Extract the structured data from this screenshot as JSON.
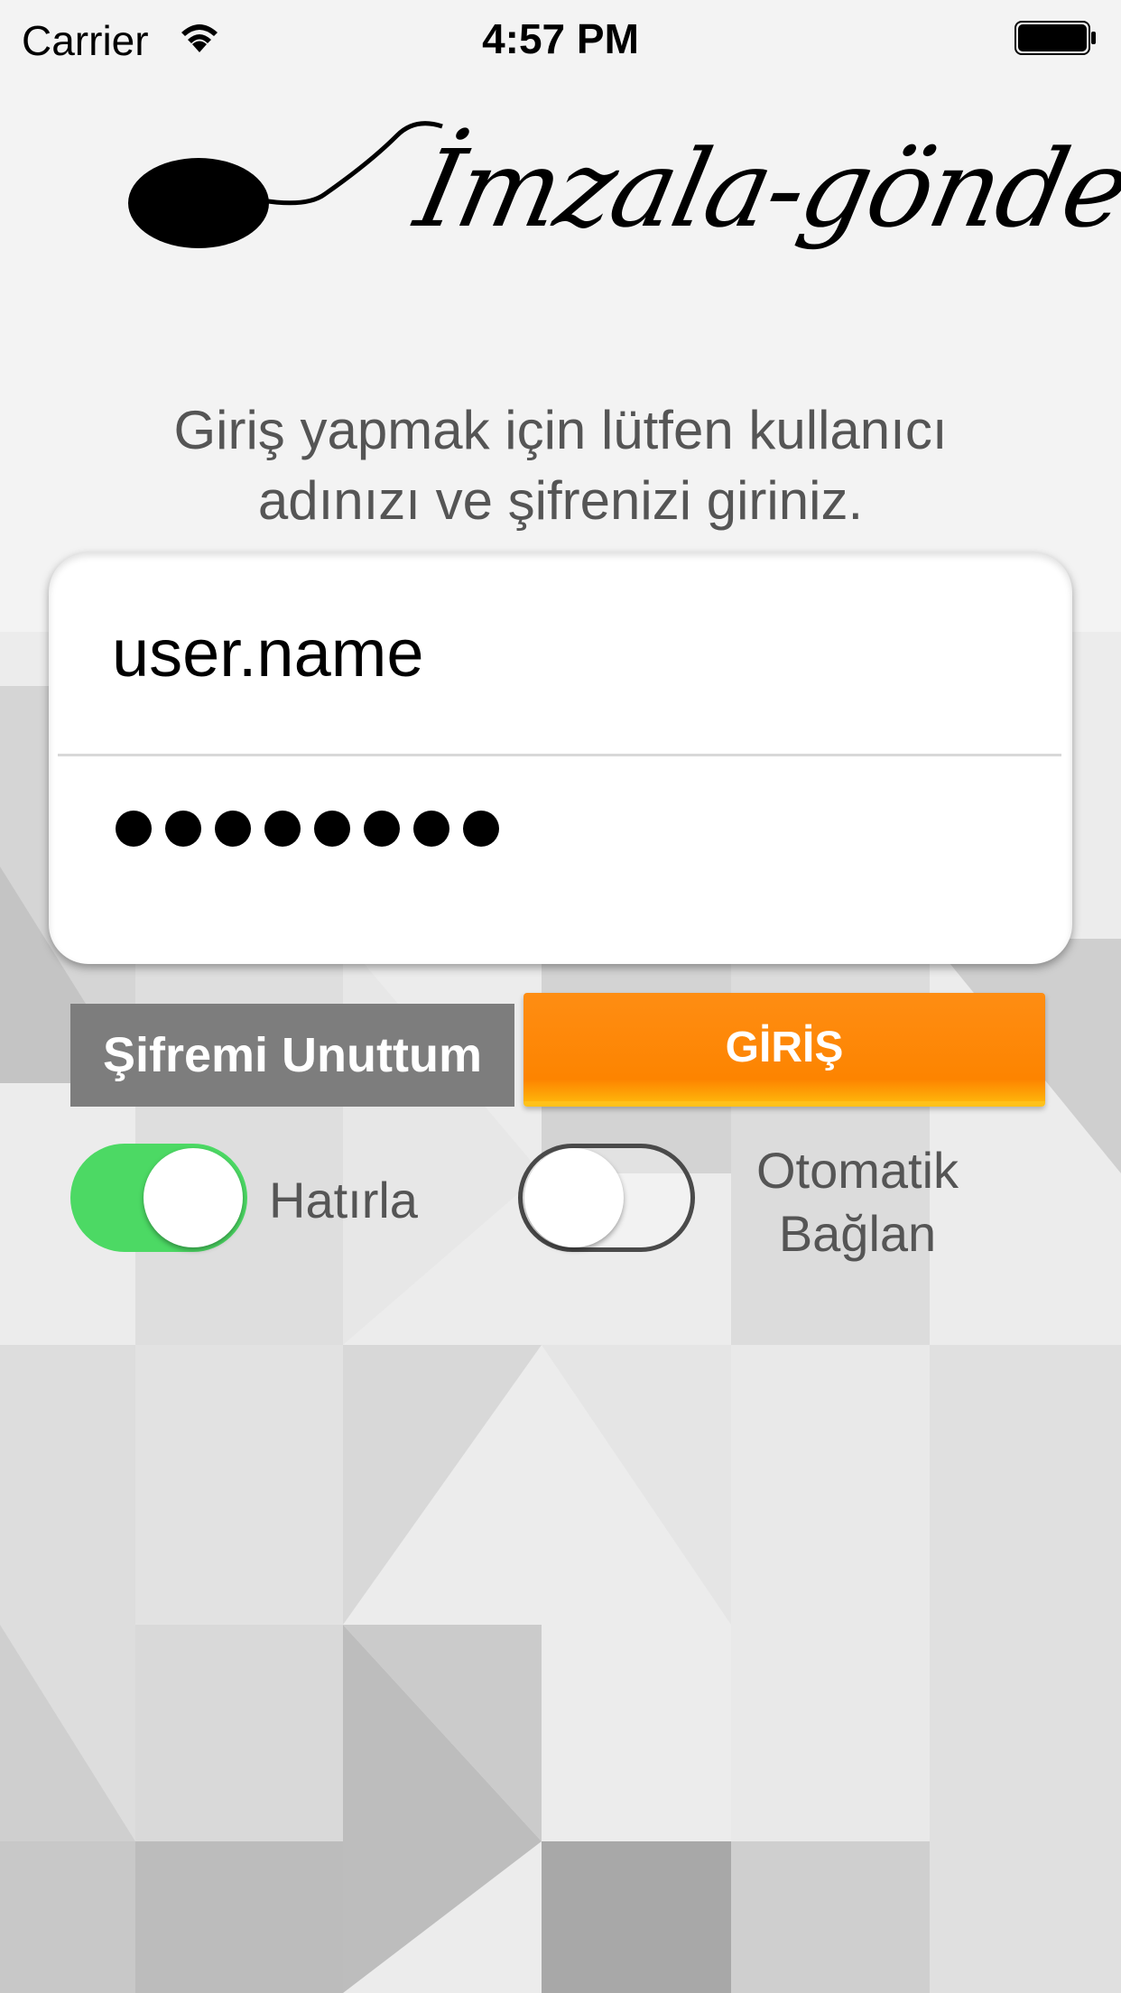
{
  "status_bar": {
    "carrier": "Carrier",
    "time": "4:57 PM",
    "wifi_icon": "wifi-icon",
    "battery_icon": "battery-icon"
  },
  "logo": {
    "text": "İmzala-gönder",
    "icon": "mouse-icon"
  },
  "instructions": {
    "line1": "Giriş yapmak için lütfen kullanıcı",
    "line2": "adınızı ve şifrenizi giriniz."
  },
  "login_form": {
    "username_value": "user.name",
    "password_masked_length": 8
  },
  "buttons": {
    "forgot_password": "Şifremi Unuttum",
    "login": "GİRİŞ"
  },
  "toggles": {
    "remember": {
      "label": "Hatırla",
      "on": true
    },
    "auto_connect": {
      "label_line1": "Otomatik",
      "label_line2": "Bağlan",
      "on": false
    }
  },
  "colors": {
    "accent_orange": "#fd8400",
    "toggle_on_green": "#4cd964",
    "forgot_gray": "#7d7d7d"
  }
}
